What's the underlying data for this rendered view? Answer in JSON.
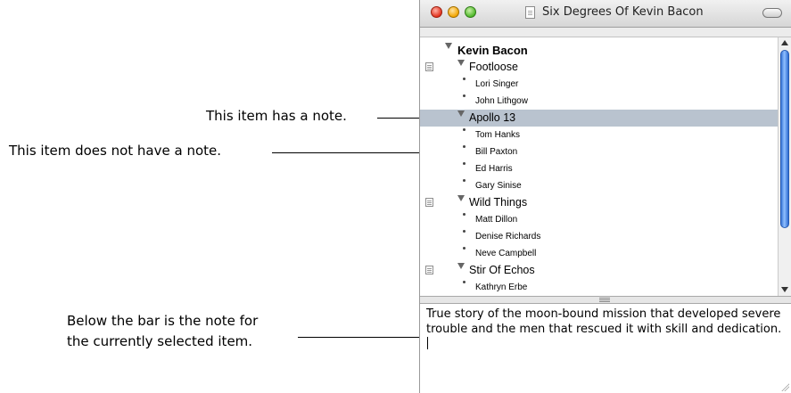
{
  "window": {
    "title": "Six Degrees Of Kevin Bacon"
  },
  "callouts": {
    "has_note": "This item has a note.",
    "no_note": "This item does not have a note.",
    "below_bar_1": "Below the bar is the note for",
    "below_bar_2": "the currently selected item."
  },
  "outline": {
    "items": [
      {
        "label": "Kevin Bacon",
        "level": 0,
        "expanded": true,
        "has_note": false,
        "selected": false
      },
      {
        "label": "Footloose",
        "level": 1,
        "expanded": true,
        "has_note": true,
        "selected": false
      },
      {
        "label": "Lori Singer",
        "level": 2,
        "has_note": false,
        "selected": false
      },
      {
        "label": "John Lithgow",
        "level": 2,
        "has_note": false,
        "selected": false
      },
      {
        "label": "Apollo 13",
        "level": 1,
        "expanded": true,
        "has_note": false,
        "selected": true
      },
      {
        "label": "Tom Hanks",
        "level": 2,
        "has_note": false,
        "selected": false
      },
      {
        "label": "Bill Paxton",
        "level": 2,
        "has_note": false,
        "selected": false
      },
      {
        "label": "Ed Harris",
        "level": 2,
        "has_note": false,
        "selected": false
      },
      {
        "label": "Gary Sinise",
        "level": 2,
        "has_note": false,
        "selected": false
      },
      {
        "label": "Wild Things",
        "level": 1,
        "expanded": true,
        "has_note": true,
        "selected": false
      },
      {
        "label": "Matt Dillon",
        "level": 2,
        "has_note": false,
        "selected": false
      },
      {
        "label": "Denise Richards",
        "level": 2,
        "has_note": false,
        "selected": false
      },
      {
        "label": "Neve Campbell",
        "level": 2,
        "has_note": false,
        "selected": false
      },
      {
        "label": "Stir Of Echos",
        "level": 1,
        "expanded": true,
        "has_note": true,
        "selected": false
      },
      {
        "label": "Kathryn Erbe",
        "level": 2,
        "has_note": false,
        "selected": false
      }
    ]
  },
  "note": {
    "text": "True story of the moon-bound mission that developed severe trouble and the men that rescued it with skill and dedication."
  },
  "colors": {
    "selection": "#b9c3cf",
    "scroll_thumb": "#3a77d8",
    "close_button": "#e2321e",
    "minimize_button": "#f2a500",
    "zoom_button": "#4fb82b"
  },
  "scroll": {
    "position_fraction": 0.0
  }
}
